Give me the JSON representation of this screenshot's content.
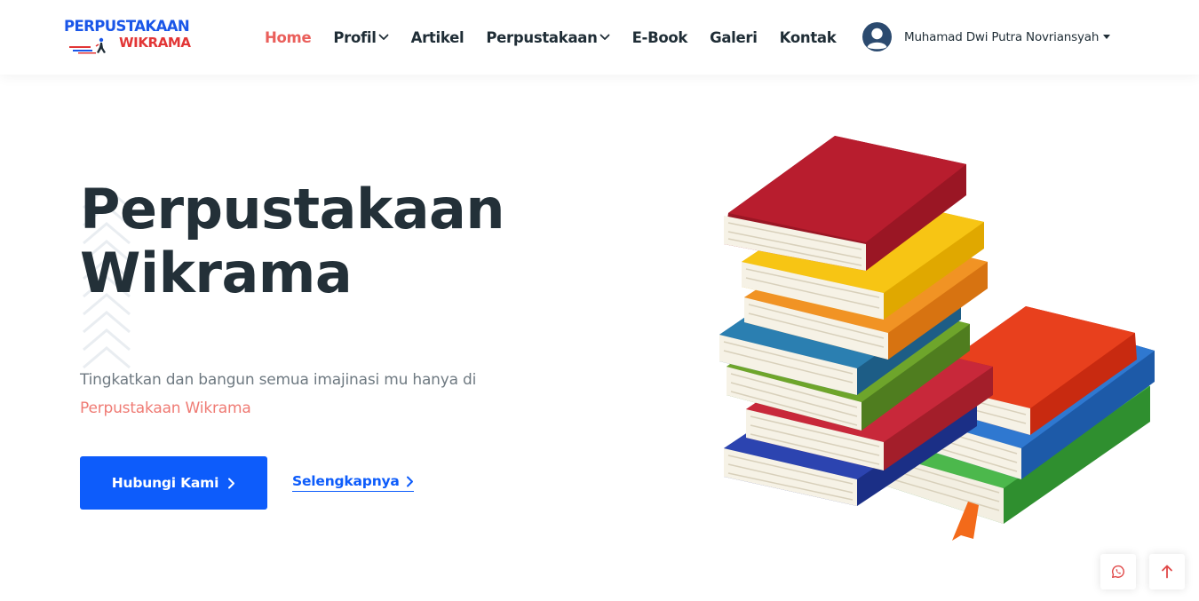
{
  "brand": {
    "line1": "PERPUSTAKAAN",
    "line2": "WIKRAMA",
    "colors": {
      "blue": "#1a56e8",
      "red": "#e23636"
    }
  },
  "nav": {
    "items": [
      {
        "label": "Home",
        "active": true,
        "dropdown": false
      },
      {
        "label": "Profil",
        "active": false,
        "dropdown": true
      },
      {
        "label": "Artikel",
        "active": false,
        "dropdown": false
      },
      {
        "label": "Perpustakaan",
        "active": false,
        "dropdown": true
      },
      {
        "label": "E-Book",
        "active": false,
        "dropdown": false
      },
      {
        "label": "Galeri",
        "active": false,
        "dropdown": false
      },
      {
        "label": "Kontak",
        "active": false,
        "dropdown": false
      }
    ],
    "active_color": "#ea5f5b"
  },
  "user": {
    "name": "Muhamad Dwi Putra Novriansyah",
    "avatar_icon": "user-avatar-icon"
  },
  "hero": {
    "title_line1": "Perpustakaan",
    "title_line2": "Wikrama",
    "subtitle_part1": "Tingkatkan dan bangun semua imajinasi mu hanya di ",
    "subtitle_highlight": "Perpustakaan Wikrama",
    "primary_button": "Hubungi Kami",
    "secondary_link": "Selengkapnya",
    "illustration_icon": "book-stack-icon",
    "accent_color": "#0d5cfb",
    "highlight_color": "#ef7b74"
  },
  "floating": {
    "whatsapp_icon": "whatsapp-icon",
    "back_to_top_icon": "arrow-up-icon"
  }
}
